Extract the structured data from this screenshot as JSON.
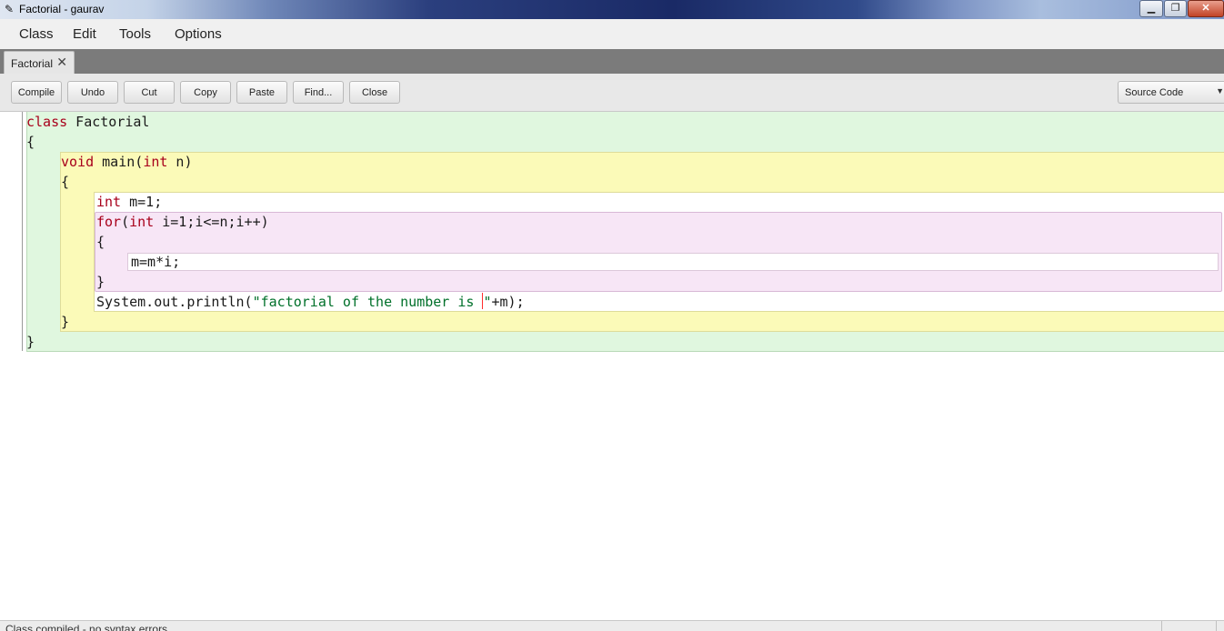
{
  "window": {
    "title": "Factorial - gaurav"
  },
  "menu": {
    "items": [
      "Class",
      "Edit",
      "Tools",
      "Options"
    ]
  },
  "tab": {
    "label": "Factorial",
    "close_glyph": "✕"
  },
  "toolbar": {
    "buttons": [
      "Compile",
      "Undo",
      "Cut",
      "Copy",
      "Paste",
      "Find...",
      "Close"
    ],
    "view_select": "Source Code"
  },
  "code": {
    "line1_kw": "class",
    "line1_rest": " Factorial",
    "line2": "{",
    "line3_kw1": "void",
    "line3_mid": " main(",
    "line3_kw2": "int",
    "line3_rest": " n)",
    "line4": "{",
    "line5_kw": "int",
    "line5_rest": " m=1;",
    "line6_kw1": "for",
    "line6_mid": "(",
    "line6_kw2": "int",
    "line6_rest": " i=1;i<=n;i++)",
    "line7": "{",
    "line8": "m=m*i;",
    "line9": "}",
    "line10_pre": "System.out.println(",
    "line10_str_a": "\"factorial of the number is ",
    "line10_str_b": "\"",
    "line10_post": "+m);",
    "line11": "}",
    "line12": "}"
  },
  "status": {
    "text": "Class compiled - no syntax errors"
  },
  "colors": {
    "keyword": "#a8001b",
    "string": "#00702a",
    "class_scope": "#e0f7df",
    "method_scope": "#fbfab8",
    "loop_scope": "#f7e6f6",
    "caret": "#ff2d2d"
  }
}
